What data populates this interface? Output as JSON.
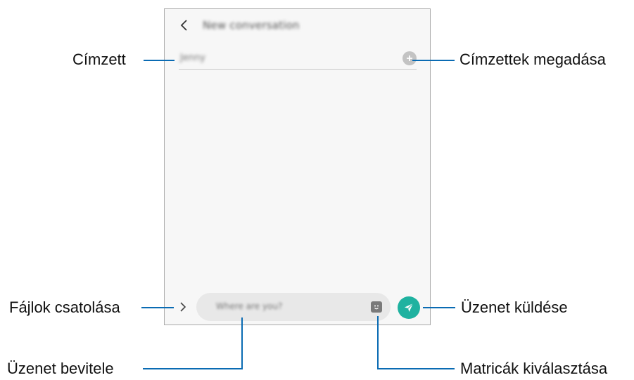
{
  "screen": {
    "title": "New conversation",
    "recipient_value": "Jenny",
    "message_placeholder": "Where are you?"
  },
  "callouts": {
    "recipient": "Címzett",
    "add_recipients": "Címzettek megadása",
    "attach_files": "Fájlok csatolása",
    "send_message": "Üzenet küldése",
    "enter_message": "Üzenet bevitele",
    "select_stickers": "Matricák kiválasztása"
  },
  "colors": {
    "callout_line": "#0a6bb3",
    "send_button": "#1fb2a0"
  },
  "icons": {
    "back": "chevron-left-icon",
    "add": "plus-circle-icon",
    "attach": "chevron-right-icon",
    "sticker": "sticker-icon",
    "send": "paper-plane-icon"
  }
}
